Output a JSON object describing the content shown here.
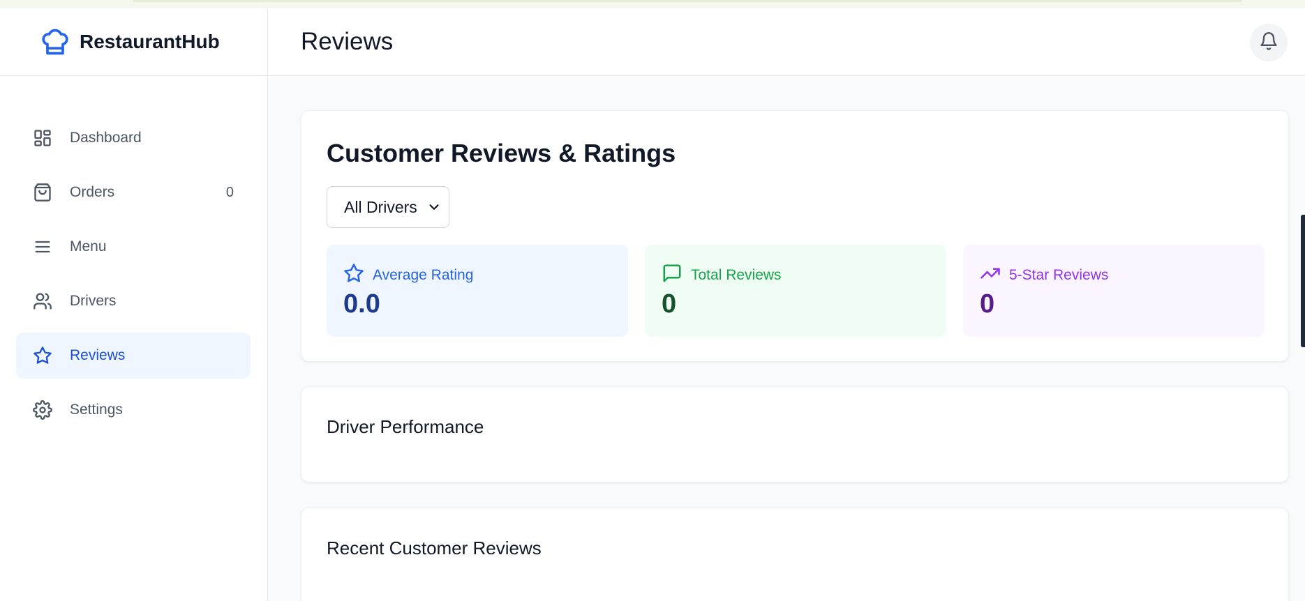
{
  "app": {
    "name": "RestaurantHub"
  },
  "sidebar": {
    "items": [
      {
        "label": "Dashboard",
        "icon": "dashboard-icon",
        "active": false
      },
      {
        "label": "Orders",
        "icon": "shopping-bag-icon",
        "badge": "0",
        "active": false
      },
      {
        "label": "Menu",
        "icon": "menu-lines-icon",
        "active": false
      },
      {
        "label": "Drivers",
        "icon": "users-icon",
        "active": false
      },
      {
        "label": "Reviews",
        "icon": "star-icon",
        "active": true
      },
      {
        "label": "Settings",
        "icon": "gear-icon",
        "active": false
      }
    ]
  },
  "header": {
    "title": "Reviews",
    "notification_icon": "bell-icon"
  },
  "main": {
    "heading": "Customer Reviews & Ratings",
    "filter": {
      "selected": "All Drivers"
    },
    "stats": [
      {
        "label": "Average Rating",
        "value": "0.0",
        "icon": "star-icon",
        "color": "#2563eb"
      },
      {
        "label": "Total Reviews",
        "value": "0",
        "icon": "message-square-icon",
        "color": "#16a34a"
      },
      {
        "label": "5-Star Reviews",
        "value": "0",
        "icon": "trending-up-icon",
        "color": "#9333ea"
      }
    ],
    "driver_performance_title": "Driver Performance",
    "recent_reviews_title": "Recent Customer Reviews"
  }
}
